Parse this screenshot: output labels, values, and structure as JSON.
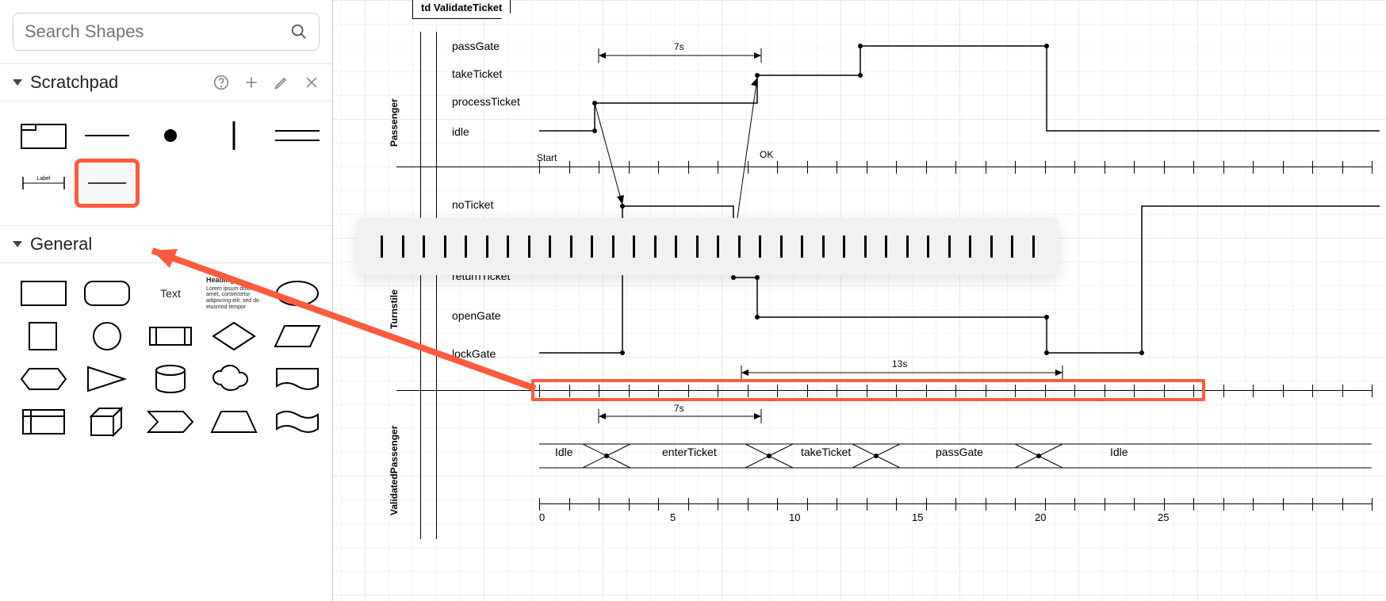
{
  "search": {
    "placeholder": "Search Shapes"
  },
  "sections": {
    "scratchpad": {
      "title": "Scratchpad"
    },
    "general": {
      "title": "General"
    }
  },
  "scratchpad_item_label": "Label",
  "general_items": {
    "text": "Text",
    "heading_title": "Heading",
    "heading_body": "Lorem ipsum dolor sit amet, consectetur adipiscing elit, sed do eiusmod tempor"
  },
  "diagram": {
    "title": "td ValidateTicket",
    "lanes": {
      "passenger": "Passenger",
      "turnstile": "Turnstile",
      "validated": "ValidatedPassenger"
    },
    "passenger_states": [
      "passGate",
      "takeTicket",
      "processTicket",
      "idle"
    ],
    "turnstile_states": [
      "noTicket",
      "returnTicket",
      "openGate",
      "lockGate"
    ],
    "events": {
      "start": "Start",
      "ok": "OK"
    },
    "durations": {
      "d7a": "7s",
      "d7b": "7s",
      "d13": "13s"
    },
    "vp_slots": [
      "Idle",
      "enterTicket",
      "takeTicket",
      "passGate",
      "Idle"
    ],
    "axis_numbers": [
      "0",
      "5",
      "10",
      "15",
      "20",
      "25"
    ]
  }
}
